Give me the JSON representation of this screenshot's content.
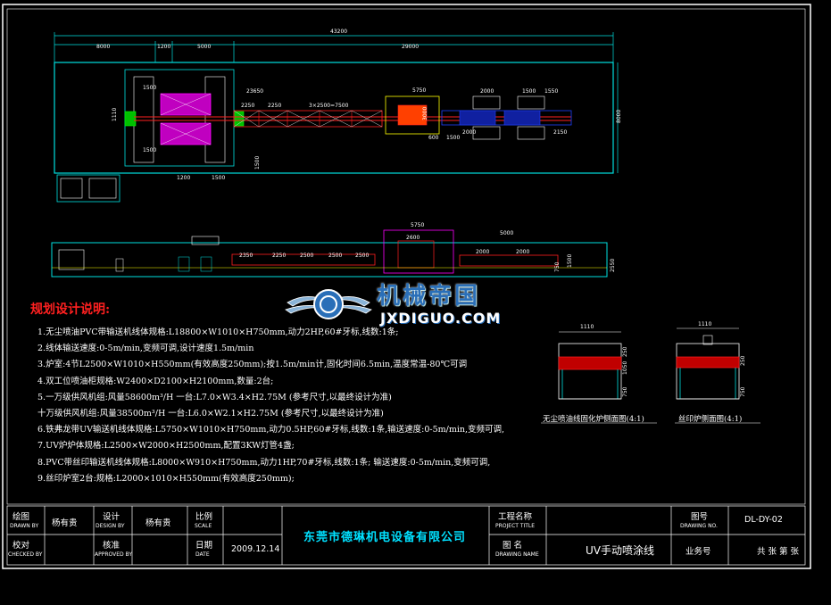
{
  "drawing": {
    "overall_dims": {
      "total": "43200",
      "seg1": "8000",
      "seg2": "1200",
      "seg3": "5000",
      "seg4": "29000",
      "height": "8000",
      "top_small1": "1500",
      "top_small2": "23650",
      "top_small3": "5750",
      "top_small4": "2000",
      "run1": "2250",
      "run2": "2250",
      "run3": "3×2500=7500",
      "bottom1": "1200",
      "bottom2": "1500",
      "bottom3": "600",
      "bottom4": "1500",
      "right1": "1550",
      "right2": "1500",
      "left1": "1110",
      "left2": "1500",
      "left3": "1500",
      "mid1": "2000",
      "mid2": "3000",
      "mid3": "2150"
    },
    "elevation_dims": {
      "a": "5750",
      "b": "2600",
      "c": "5000",
      "d": "2350",
      "e": "2250",
      "f": "2500",
      "g": "2500",
      "h": "2500",
      "i": "2000",
      "j": "2000",
      "k": "1500",
      "l": "2550",
      "m": "750"
    }
  },
  "notes": {
    "heading": "规划设计说明:",
    "lines": [
      "1.无尘喷油PVC带输送机线体规格:L18800×W1010×H750mm,动力2HP,60#牙标,线数:1条;",
      "2.线体输送速度:0-5m/min,变频可调,设计速度1.5m/min",
      "3.炉室:4节L2500×W1010×H550mm(有效高度250mm);按1.5m/min计,固化时间6.5min,温度常温-80℃可调",
      "4.双工位喷油柜规格:W2400×D2100×H2100mm,数量:2台;",
      "5.一万级供风机组:风量58600m³/H 一台:L7.0×W3.4×H2.75M (参考尺寸,以最终设计为准)",
      "   十万级供风机组:风量38500m³/H 一台:L6.0×W2.1×H2.75M (参考尺寸,以最终设计为准)",
      "6.铁弗龙带UV输送机线体规格:L5750×W1010×H750mm,动力0.5HP,60#牙标,线数:1条,输送速度:0-5m/min,变频可调,",
      "7.UV炉炉体规格:L2500×W2000×H2500mm,配置3KW灯管4盏;",
      "8.PVC带丝印输送机线体规格:L8000×W910×H750mm,动力1HP,70#牙标,线数:1条;  输送速度:0-5m/min,变频可调,",
      "9.丝印炉室2台:规格:L2000×1010×H550mm(有效高度250mm);"
    ]
  },
  "watermark": {
    "cn": "机械帝国",
    "en": "JXDIGUO.COM"
  },
  "sections": {
    "left_title": "无尘喷油线固化炉侧面图(4:1)",
    "right_title": "丝印炉侧面图(4:1)",
    "left_dims": [
      "1110",
      "1050",
      "750",
      "250"
    ],
    "right_dims": [
      "1110",
      "250",
      "750"
    ]
  },
  "title_block": {
    "drawn_by_cn": "绘图",
    "drawn_by_en": "DRAWN BY",
    "drawn_by_val": "杨有贵",
    "design_by_cn": "设计",
    "design_by_en": "DESIGN BY",
    "design_by_val": "杨有贵",
    "scale_cn": "比例",
    "scale_en": "SCALE",
    "checked_cn": "校对",
    "checked_en": "CHECKED BY",
    "approved_cn": "核准",
    "approved_en": "APPROVED BY",
    "date_cn": "日期",
    "date_en": "DATE",
    "date_val": "2009.12.14",
    "company": "东莞市德琳机电设备有限公司",
    "project_cn": "工程名称",
    "project_en": "PROJECT TITLE",
    "drawing_name_cn": "图 名",
    "drawing_name_en": "DRAWING NAME",
    "drawing_name_val": "UV手动喷涂线",
    "drawing_no_cn": "图号",
    "drawing_no_en": "DRAWING NO.",
    "drawing_no_val": "DL-DY-02",
    "business_cn": "业务号",
    "sheets": "共 张 第 张"
  },
  "colors": {
    "cyan": "#00e0e0",
    "magenta": "#ff00ff",
    "red": "#ff2020",
    "yellow": "#ffff00",
    "green": "#00ff00",
    "white": "#ffffff",
    "blue": "#2040ff"
  }
}
